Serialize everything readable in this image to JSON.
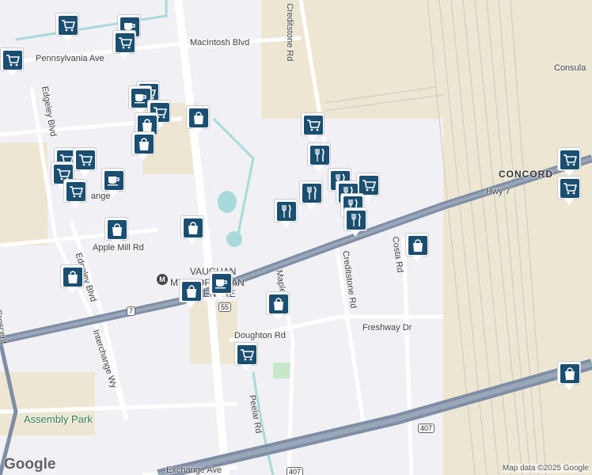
{
  "map": {
    "labels": {
      "creditstone_top": "Creditstone Rd",
      "macintosh": "MacIntosh Blvd",
      "pennsylvania": "Pennsylvania Ave",
      "edgeley": "Edgeley Blvd",
      "consula": "Consula",
      "concord": "CONCORD",
      "hwy7": "Hwy 7",
      "apple_mill": "Apple Mill Rd",
      "vaughan_1": "VAUGHAN",
      "vaughan_2": "METROPOLITAN",
      "vaughan_3": "CENTRE",
      "maple": "Maple",
      "creditstone_mid": "Creditstone Rd",
      "costa": "Costa Rd",
      "doughton": "Doughton Rd",
      "freshway": "Freshway Dr",
      "edgeley_low": "Edgeley Blvd",
      "interchange": "Interchange Wy",
      "assembly_park": "Assembly Park",
      "peelar": "Peelar Rd",
      "exchange": "Exchange Ave",
      "ange": "ange",
      "crescent": "Crescent"
    },
    "shields": {
      "s7": "7",
      "s55": "55",
      "s407a": "407",
      "s407b": "407"
    },
    "metro": "M",
    "attribution": "Map data ©2025 Google",
    "logo": "Google",
    "colors": {
      "pin": "#1b4f72",
      "road": "#ffffff",
      "highway": "#7f8ea5",
      "water": "#a8dadc",
      "park": "#c8e6c9",
      "industrial": "#ece6d2"
    },
    "pins": [
      {
        "type": "grocery"
      },
      {
        "type": "cafe"
      },
      {
        "type": "grocery"
      },
      {
        "type": "grocery"
      },
      {
        "type": "grocery"
      },
      {
        "type": "cafe"
      },
      {
        "type": "grocery"
      },
      {
        "type": "shopping"
      },
      {
        "type": "shopping"
      },
      {
        "type": "shopping"
      },
      {
        "type": "grocery"
      },
      {
        "type": "grocery"
      },
      {
        "type": "grocery"
      },
      {
        "type": "grocery"
      },
      {
        "type": "cafe"
      },
      {
        "type": "shopping"
      },
      {
        "type": "shopping"
      },
      {
        "type": "shopping"
      },
      {
        "type": "cafe"
      },
      {
        "type": "grocery"
      },
      {
        "type": "restaurant"
      },
      {
        "type": "restaurant"
      },
      {
        "type": "restaurant"
      },
      {
        "type": "restaurant"
      },
      {
        "type": "grocery"
      },
      {
        "type": "restaurant"
      },
      {
        "type": "restaurant"
      },
      {
        "type": "restaurant"
      },
      {
        "type": "shopping"
      },
      {
        "type": "shopping"
      },
      {
        "type": "shopping"
      },
      {
        "type": "grocery"
      },
      {
        "type": "grocery"
      },
      {
        "type": "grocery"
      },
      {
        "type": "shopping"
      }
    ]
  }
}
